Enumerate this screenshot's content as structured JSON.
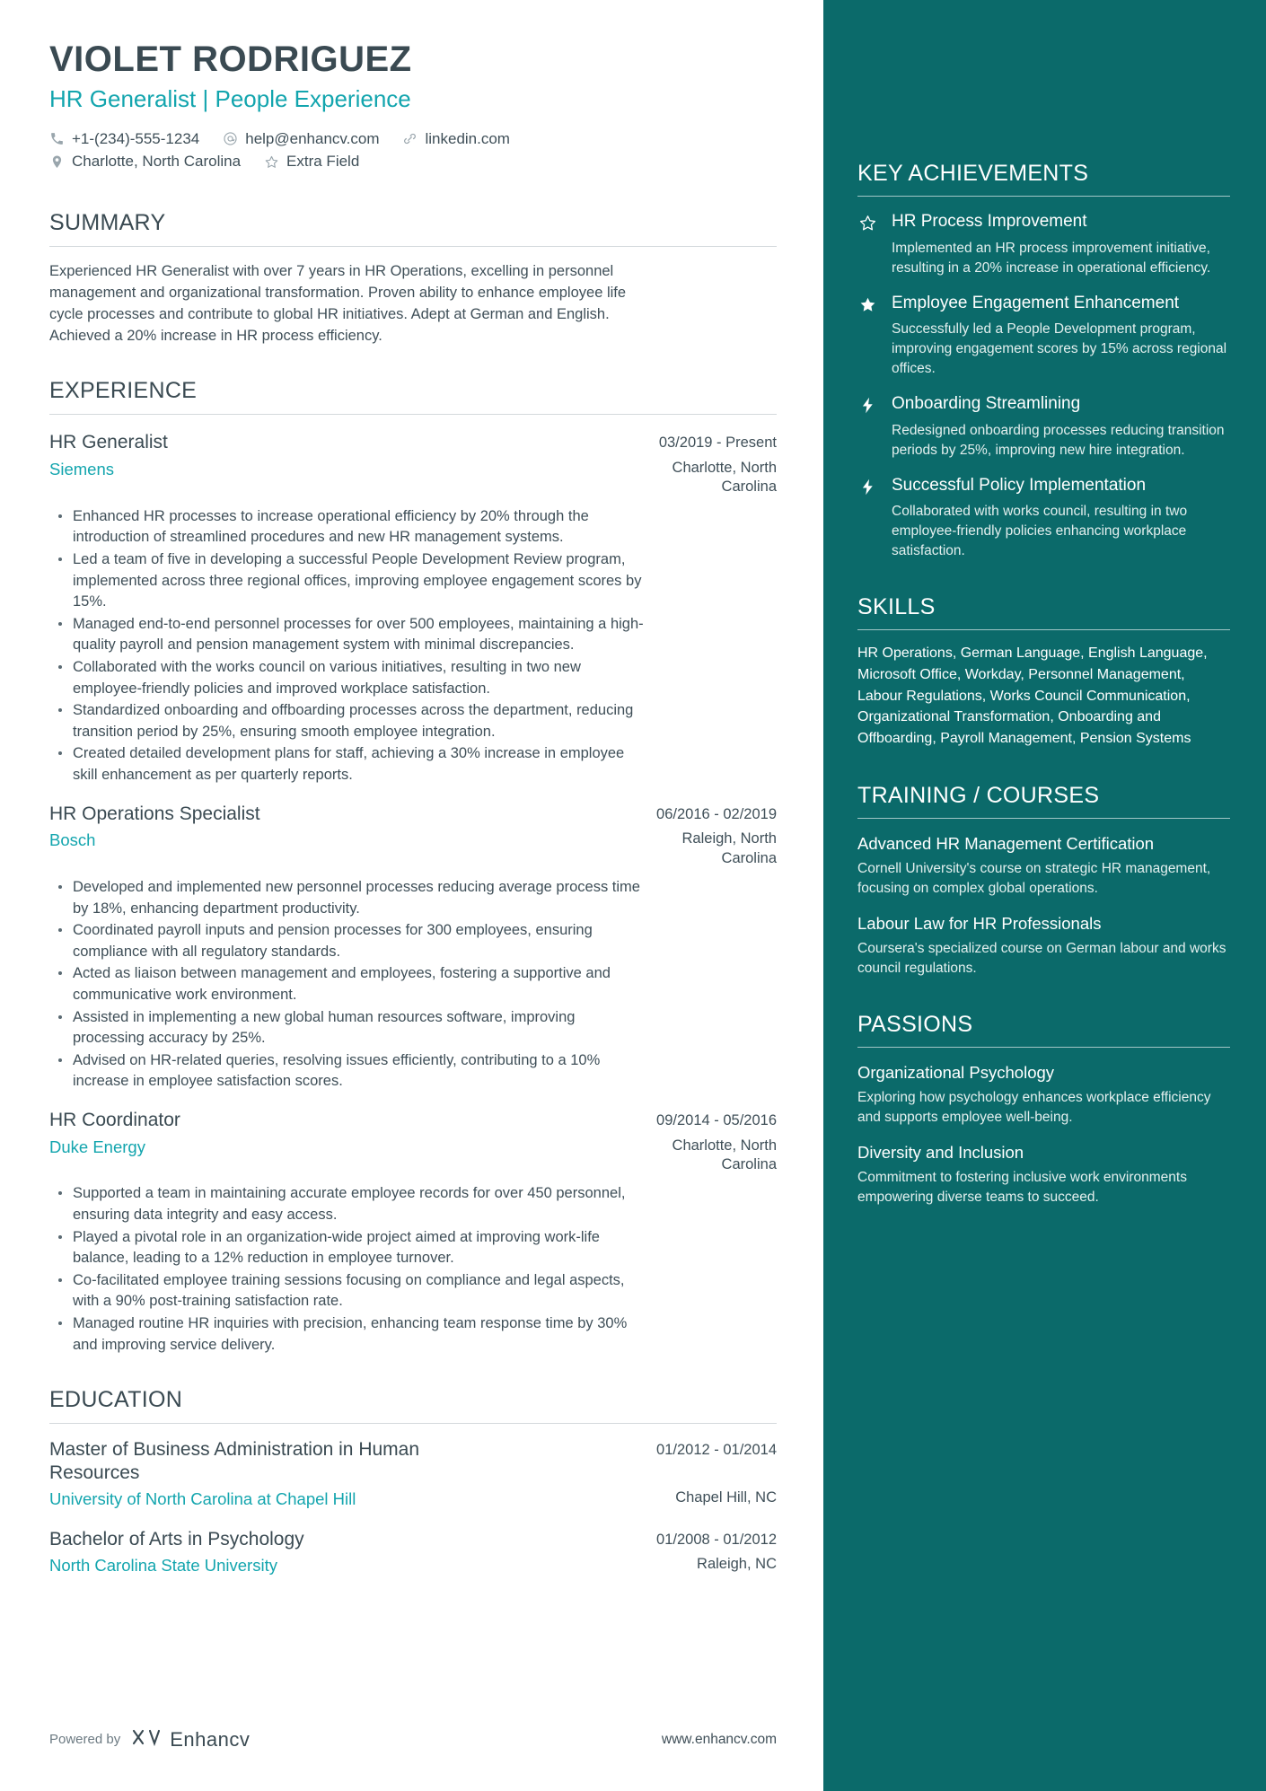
{
  "header": {
    "name": "VIOLET RODRIGUEZ",
    "headline": "HR Generalist | People Experience",
    "contacts_row1": [
      {
        "icon": "phone-icon",
        "text": "+1-(234)-555-1234"
      },
      {
        "icon": "email-icon",
        "text": "help@enhancv.com"
      },
      {
        "icon": "link-icon",
        "text": "linkedin.com"
      }
    ],
    "contacts_row2": [
      {
        "icon": "location-pin-icon",
        "text": "Charlotte, North Carolina"
      },
      {
        "icon": "star-outline-icon",
        "text": "Extra Field"
      }
    ]
  },
  "colors": {
    "sidebar_bg": "#0b6a6a",
    "accent_teal": "#13a5ae",
    "heading": "#3a4a52",
    "body_text": "#3f4f58"
  },
  "summary": {
    "title": "SUMMARY",
    "text": "Experienced HR Generalist with over 7 years in HR Operations, excelling in personnel management and organizational transformation. Proven ability to enhance employee life cycle processes and contribute to global HR initiatives. Adept at German and English. Achieved a 20% increase in HR process efficiency."
  },
  "experience": {
    "title": "EXPERIENCE",
    "entries": [
      {
        "title": "HR Generalist",
        "date": "03/2019 - Present",
        "company": "Siemens",
        "location": "Charlotte, North Carolina",
        "bullets": [
          "Enhanced HR processes to increase operational efficiency by 20% through the introduction of streamlined procedures and new HR management systems.",
          "Led a team of five in developing a successful People Development Review program, implemented across three regional offices, improving employee engagement scores by 15%.",
          "Managed end-to-end personnel processes for over 500 employees, maintaining a high-quality payroll and pension management system with minimal discrepancies.",
          "Collaborated with the works council on various initiatives, resulting in two new employee-friendly policies and improved workplace satisfaction.",
          "Standardized onboarding and offboarding processes across the department, reducing transition period by 25%, ensuring smooth employee integration.",
          "Created detailed development plans for staff, achieving a 30% increase in employee skill enhancement as per quarterly reports."
        ]
      },
      {
        "title": "HR Operations Specialist",
        "date": "06/2016 - 02/2019",
        "company": "Bosch",
        "location": "Raleigh, North Carolina",
        "bullets": [
          "Developed and implemented new personnel processes reducing average process time by 18%, enhancing department productivity.",
          "Coordinated payroll inputs and pension processes for 300 employees, ensuring compliance with all regulatory standards.",
          "Acted as liaison between management and employees, fostering a supportive and communicative work environment.",
          "Assisted in implementing a new global human resources software, improving processing accuracy by 25%.",
          "Advised on HR-related queries, resolving issues efficiently, contributing to a 10% increase in employee satisfaction scores."
        ]
      },
      {
        "title": "HR Coordinator",
        "date": "09/2014 - 05/2016",
        "company": "Duke Energy",
        "location": "Charlotte, North Carolina",
        "bullets": [
          "Supported a team in maintaining accurate employee records for over 450 personnel, ensuring data integrity and easy access.",
          "Played a pivotal role in an organization-wide project aimed at improving work-life balance, leading to a 12% reduction in employee turnover.",
          "Co-facilitated employee training sessions focusing on compliance and legal aspects, with a 90% post-training satisfaction rate.",
          "Managed routine HR inquiries with precision, enhancing team response time by 30% and improving service delivery."
        ]
      }
    ]
  },
  "education": {
    "title": "EDUCATION",
    "entries": [
      {
        "title": "Master of Business Administration in Human Resources",
        "date": "01/2012 - 01/2014",
        "school": "University of North Carolina at Chapel Hill",
        "location": "Chapel Hill, NC"
      },
      {
        "title": "Bachelor of Arts in Psychology",
        "date": "01/2008 - 01/2012",
        "school": "North Carolina State University",
        "location": "Raleigh, NC"
      }
    ]
  },
  "footer": {
    "powered_by": "Powered by",
    "brand": "Enhancv",
    "url": "www.enhancv.com"
  },
  "sidebar": {
    "key_achievements": {
      "title": "KEY ACHIEVEMENTS",
      "items": [
        {
          "icon": "star-outline-icon",
          "title": "HR Process Improvement",
          "desc": "Implemented an HR process improvement initiative, resulting in a 20% increase in operational efficiency."
        },
        {
          "icon": "star-filled-icon",
          "title": "Employee Engagement Enhancement",
          "desc": "Successfully led a People Development program, improving engagement scores by 15% across regional offices."
        },
        {
          "icon": "lightning-bolt-icon",
          "title": "Onboarding Streamlining",
          "desc": "Redesigned onboarding processes reducing transition periods by 25%, improving new hire integration."
        },
        {
          "icon": "lightning-bolt-icon",
          "title": "Successful Policy Implementation",
          "desc": "Collaborated with works council, resulting in two employee-friendly policies enhancing workplace satisfaction."
        }
      ]
    },
    "skills": {
      "title": "SKILLS",
      "text": "HR Operations, German Language, English Language, Microsoft Office, Workday, Personnel Management, Labour Regulations, Works Council Communication, Organizational Transformation, Onboarding and Offboarding, Payroll Management, Pension Systems"
    },
    "training": {
      "title": "TRAINING / COURSES",
      "items": [
        {
          "title": "Advanced HR Management Certification",
          "desc": "Cornell University's course on strategic HR management, focusing on complex global operations."
        },
        {
          "title": "Labour Law for HR Professionals",
          "desc": "Coursera's specialized course on German labour and works council regulations."
        }
      ]
    },
    "passions": {
      "title": "PASSIONS",
      "items": [
        {
          "title": "Organizational Psychology",
          "desc": "Exploring how psychology enhances workplace efficiency and supports employee well-being."
        },
        {
          "title": "Diversity and Inclusion",
          "desc": "Commitment to fostering inclusive work environments empowering diverse teams to succeed."
        }
      ]
    }
  }
}
